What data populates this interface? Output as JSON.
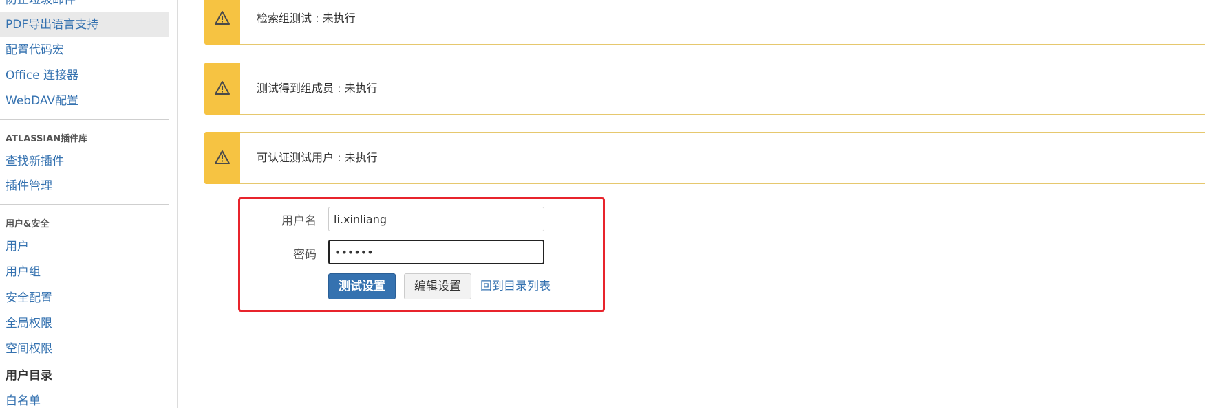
{
  "sidebar": {
    "items_top": [
      {
        "label": "防止垃圾邮件"
      },
      {
        "label": "PDF导出语言支持"
      },
      {
        "label": "配置代码宏"
      },
      {
        "label": "Office 连接器"
      },
      {
        "label": "WebDAV配置"
      }
    ],
    "atlassian_heading": "ATLASSIAN插件库",
    "atlassian_items": [
      {
        "label": "查找新插件"
      },
      {
        "label": "插件管理"
      }
    ],
    "security_heading": "用户&安全",
    "security_items": [
      {
        "label": "用户"
      },
      {
        "label": "用户组"
      },
      {
        "label": "安全配置"
      },
      {
        "label": "全局权限"
      },
      {
        "label": "空间权限"
      },
      {
        "label": "用户目录"
      },
      {
        "label": "白名单"
      }
    ]
  },
  "warnings": [
    {
      "text": "检索组测试 : 未执行",
      "icon": "warning-icon"
    },
    {
      "text": "测试得到组成员 : 未执行",
      "icon": "warning-icon"
    },
    {
      "text": "可认证测试用户 : 未执行",
      "icon": "warning-icon"
    }
  ],
  "form": {
    "username_label": "用户名",
    "username_value": "li.xinliang",
    "password_label": "密码",
    "password_value": "••••••",
    "test_button": "测试设置",
    "edit_button": "编辑设置",
    "back_link": "回到目录列表"
  },
  "colors": {
    "link": "#3572b0",
    "warning": "#f6c342",
    "highlight": "#e8242c",
    "primary_button": "#3572b0"
  }
}
